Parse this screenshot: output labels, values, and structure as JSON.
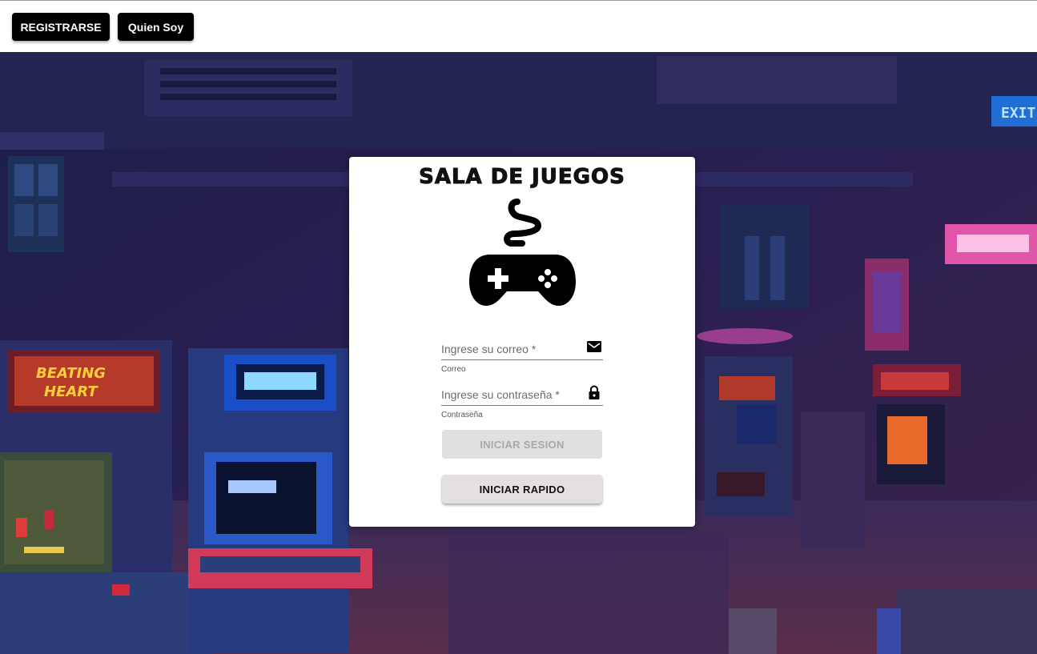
{
  "nav": {
    "register_label": "REGISTRARSE",
    "about_label": "Quien Soy"
  },
  "login": {
    "title": "SALA DE JUEGOS",
    "logo_icon": "gamepad-icon",
    "email": {
      "placeholder": "Ingrese su correo *",
      "value": "",
      "hint": "Correo",
      "icon": "mail-icon"
    },
    "password": {
      "placeholder": "Ingrese su contraseña *",
      "value": "",
      "hint": "Contraseña",
      "icon": "lock-icon"
    },
    "submit_label": "INICIAR SESION",
    "quick_label": "INICIAR RAPIDO"
  },
  "background": {
    "description_icon": "arcade-background-image",
    "exit_sign_text": "EXIT"
  },
  "colors": {
    "nav_button_bg": "#000000",
    "card_bg": "#ffffff",
    "disabled_button_bg": "#e0e0e0",
    "quick_button_bg": "#e4e0e0"
  }
}
